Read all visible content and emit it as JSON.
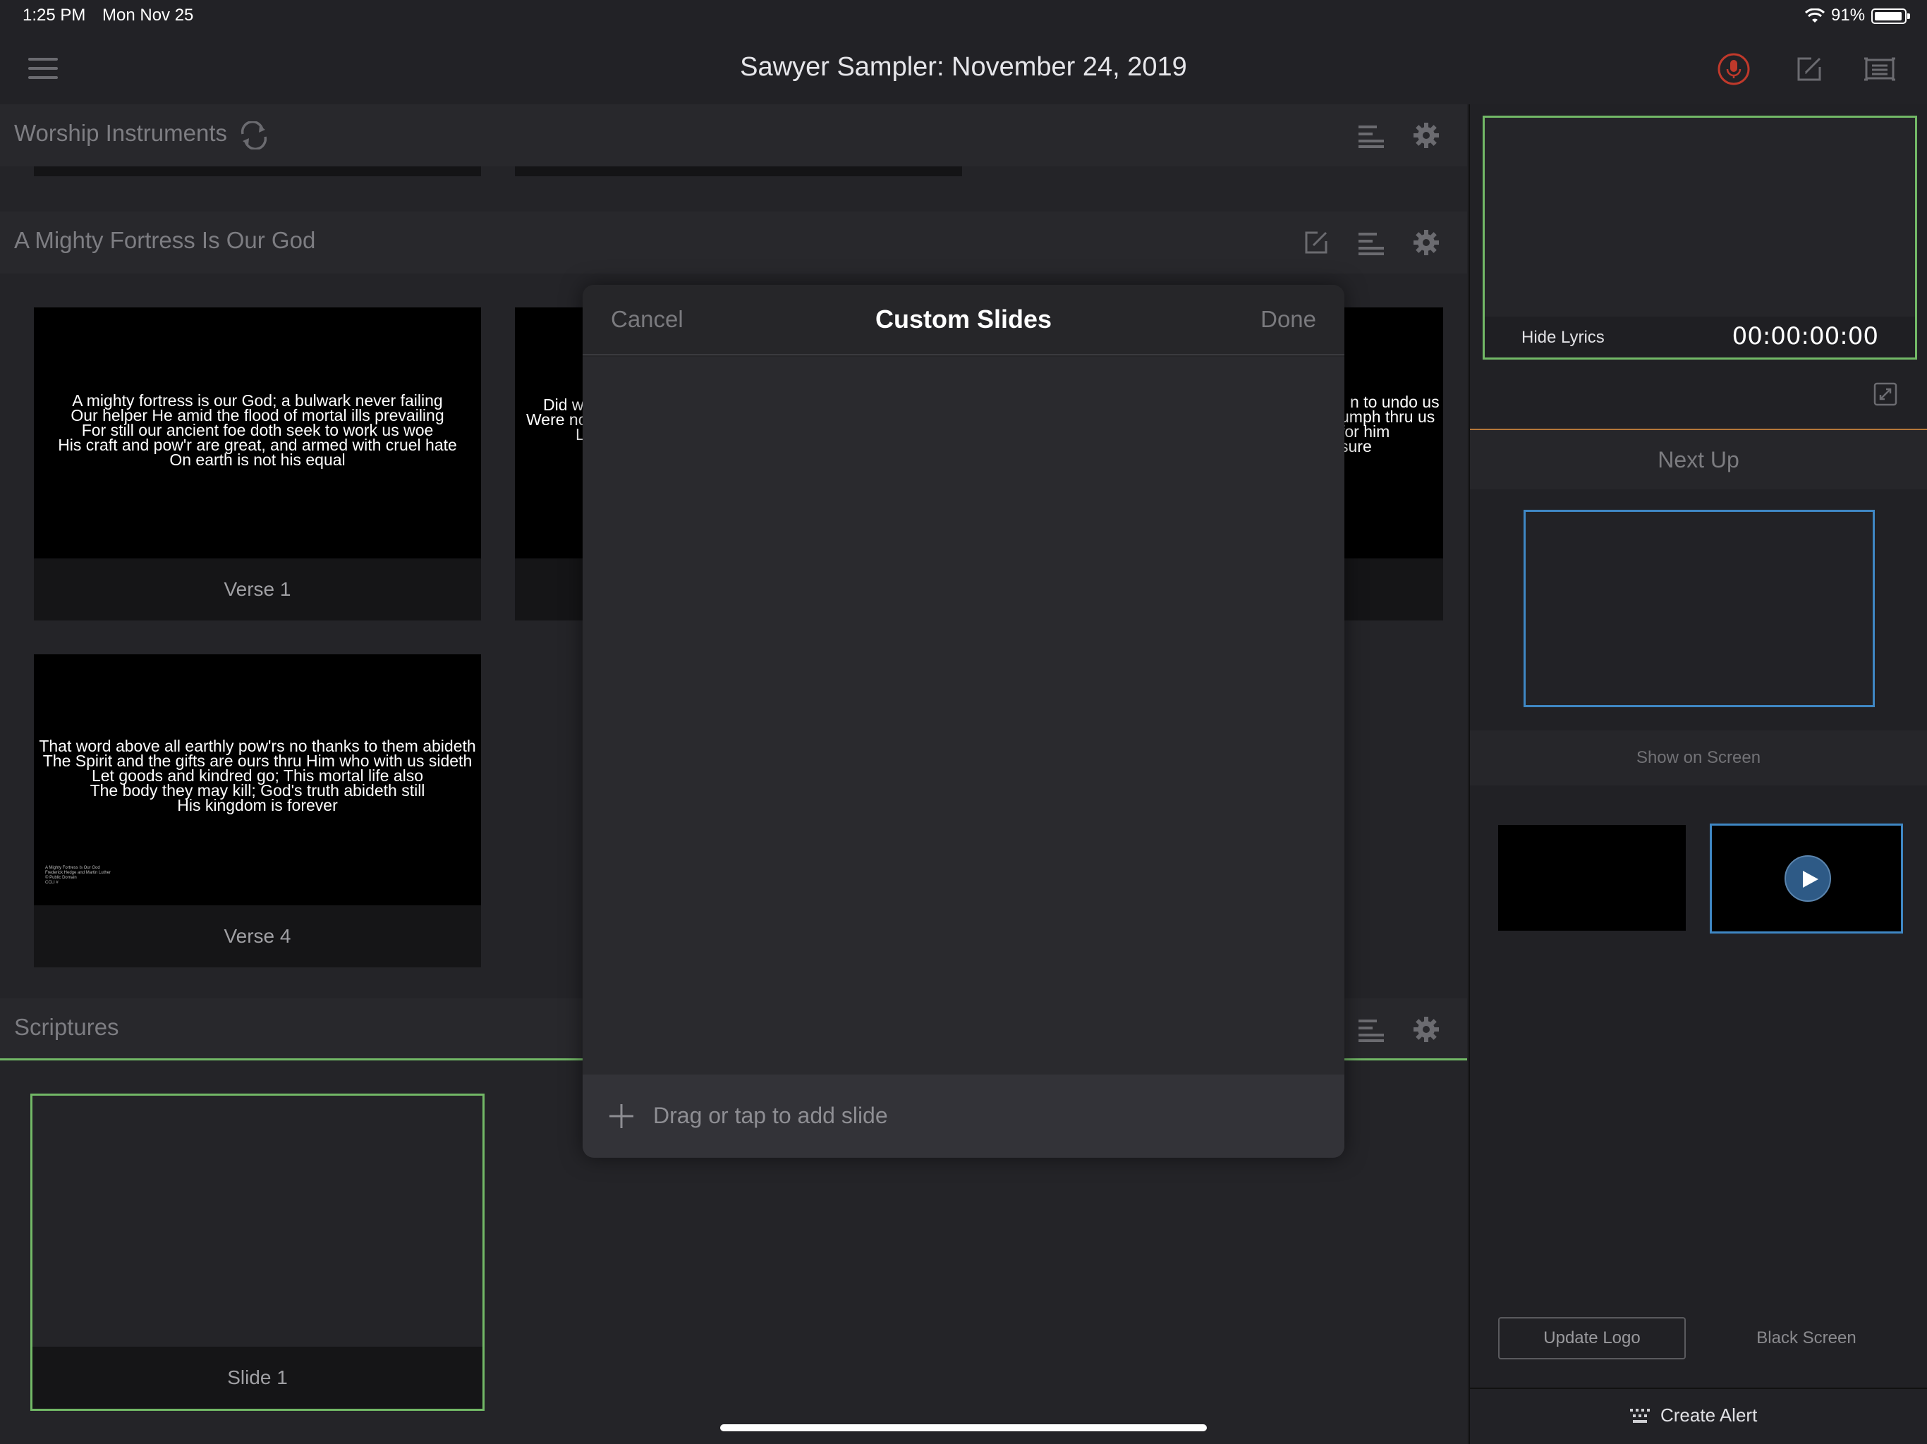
{
  "status_bar": {
    "time": "1:25 PM",
    "date": "Mon Nov 25",
    "battery_percent": "91%",
    "battery_level": 0.91,
    "icons": [
      "wifi-icon",
      "battery-icon"
    ]
  },
  "title_bar": {
    "title": "Sawyer Sampler: November 24, 2019",
    "icons": [
      "menu-icon",
      "microphone-icon",
      "edit-icon",
      "screen-icon"
    ],
    "mic_color": "#c0392b"
  },
  "sections": [
    {
      "title": "Worship Instruments",
      "icons": [
        "sync-icon",
        "align-icon",
        "gear-icon"
      ]
    },
    {
      "title": "A Mighty Fortress Is Our God",
      "icons": [
        "edit-icon",
        "align-icon",
        "gear-icon"
      ],
      "slides": [
        {
          "label": "Verse 1",
          "lines": [
            "A mighty fortress is our God; a bulwark never failing",
            "Our helper He amid the flood of mortal ills prevailing",
            "For still our ancient foe doth seek to work us woe",
            "His craft and pow'r are great, and armed with cruel hate",
            "On earth is not his equal"
          ]
        },
        {
          "label": "",
          "lines": [
            "Did we",
            "Were no",
            "L"
          ]
        },
        {
          "label": "",
          "lines": [
            "n to undo us",
            "umph thru us",
            "for him",
            "sure"
          ]
        },
        {
          "label": "Verse 4",
          "lines": [
            "That word above all earthly pow'rs no thanks to them abideth",
            "The Spirit and the gifts are ours thru Him who with us sideth",
            "Let goods and kindred go; This mortal life also",
            "The body they may kill; God's truth abideth still",
            "His kingdom is forever"
          ],
          "fine_print": [
            "A Mighty Fortress Is Our God",
            "Frederick Hedge and Martin Luther",
            "© Public Domain",
            "CCLI #"
          ]
        }
      ]
    },
    {
      "title": "Scriptures",
      "icons": [
        "align-icon",
        "gear-icon"
      ],
      "slides": [
        {
          "label": "Slide 1"
        }
      ]
    }
  ],
  "right_panel": {
    "hide_lyrics": "Hide Lyrics",
    "timer": "00:00:00:00",
    "next_up": "Next Up",
    "show_on_screen": "Show on Screen",
    "update_logo": "Update Logo",
    "black_screen": "Black Screen",
    "create_alert": "Create Alert",
    "icons": [
      "expand-icon",
      "play-icon",
      "keyboard-icon"
    ],
    "accent_green": "#72b866",
    "accent_blue": "#3f87c4",
    "accent_orange": "#b5783a"
  },
  "modal": {
    "cancel": "Cancel",
    "title": "Custom Slides",
    "done": "Done",
    "add_slide": "Drag or tap to add slide",
    "icons": [
      "plus-icon"
    ]
  }
}
